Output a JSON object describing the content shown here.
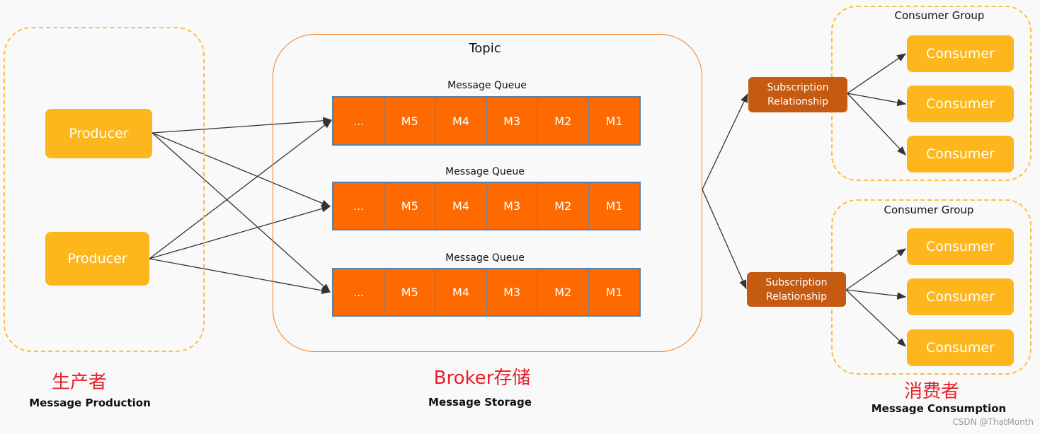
{
  "production": {
    "producers": [
      "Producer",
      "Producer"
    ],
    "label_cn": "生产者",
    "label_en": "Message Production"
  },
  "broker": {
    "topic": "Topic",
    "queues": [
      {
        "label": "Message Queue",
        "cells": [
          "...",
          "M5",
          "M4",
          "M3",
          "M2",
          "M1"
        ]
      },
      {
        "label": "Message Queue",
        "cells": [
          "...",
          "M5",
          "M4",
          "M3",
          "M2",
          "M1"
        ]
      },
      {
        "label": "Message Queue",
        "cells": [
          "...",
          "M5",
          "M4",
          "M3",
          "M2",
          "M1"
        ]
      }
    ],
    "label_cn": "Broker存储",
    "label_en": "Message Storage"
  },
  "consumption": {
    "groups": [
      {
        "label": "Consumer Group",
        "subscription": "Subscription Relationship",
        "consumers": [
          "Consumer",
          "Consumer",
          "Consumer"
        ]
      },
      {
        "label": "Consumer Group",
        "subscription": "Subscription Relationship",
        "consumers": [
          "Consumer",
          "Consumer",
          "Consumer"
        ]
      }
    ],
    "label_cn": "消费者",
    "label_en": "Message Consumption"
  },
  "watermark": "CSDN @ThatMonth",
  "colors": {
    "producer": "#fdb71d",
    "queue": "#ff6a00",
    "subscription": "#c55a11",
    "label_cn": "#e8202a"
  }
}
